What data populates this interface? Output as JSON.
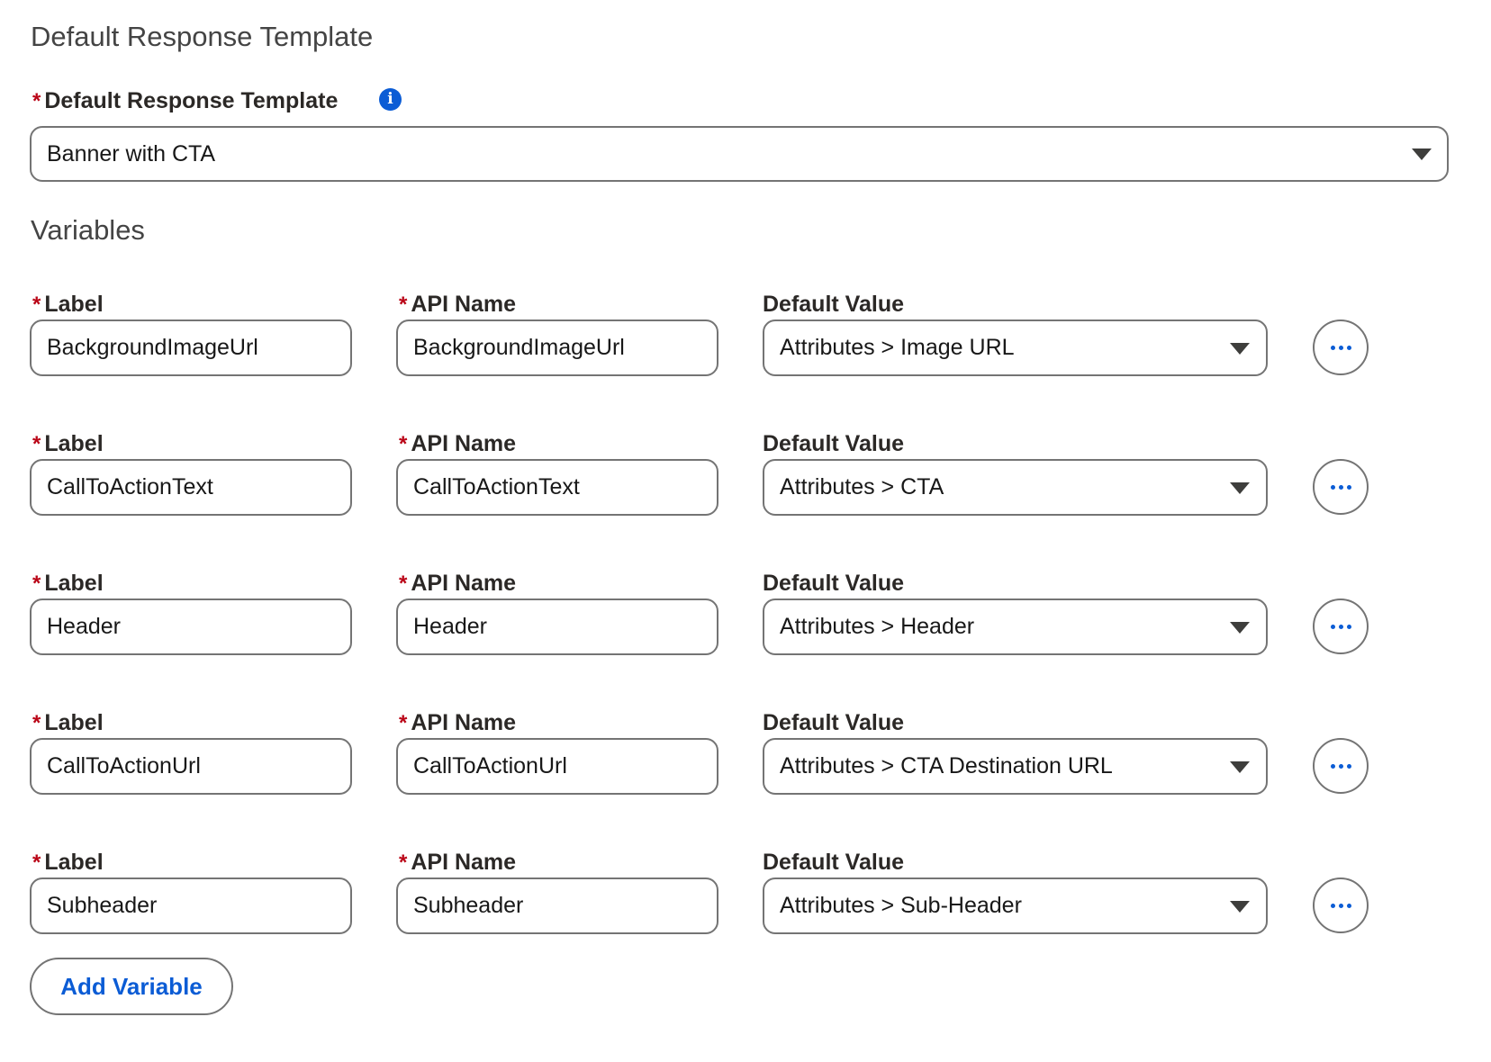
{
  "template_section": {
    "title": "Default Response Template",
    "field_label": "Default Response Template",
    "required_marker": "*",
    "info_icon": "info-icon",
    "selected_value": "Banner with CTA"
  },
  "variables_section": {
    "title": "Variables",
    "required_marker": "*",
    "rows": [
      {
        "label_header": "Label",
        "api_header": "API Name",
        "default_header": "Default Value",
        "label": "BackgroundImageUrl",
        "api_name": "BackgroundImageUrl",
        "default_value": "Attributes > Image URL"
      },
      {
        "label_header": "Label",
        "api_header": "API Name",
        "default_header": "Default Value",
        "label": "CallToActionText",
        "api_name": "CallToActionText",
        "default_value": "Attributes > CTA"
      },
      {
        "label_header": "Label",
        "api_header": "API Name",
        "default_header": "Default Value",
        "label": "Header",
        "api_name": "Header",
        "default_value": "Attributes > Header"
      },
      {
        "label_header": "Label",
        "api_header": "API Name",
        "default_header": "Default Value",
        "label": "CallToActionUrl",
        "api_name": "CallToActionUrl",
        "default_value": "Attributes > CTA Destination URL"
      },
      {
        "label_header": "Label",
        "api_header": "API Name",
        "default_header": "Default Value",
        "label": "Subheader",
        "api_name": "Subheader",
        "default_value": "Attributes > Sub-Header"
      }
    ],
    "more_actions_icon": "ellipsis-icon",
    "add_button_label": "Add Variable"
  },
  "colors": {
    "accent": "#0b5cd5",
    "required": "#ba0517",
    "border": "#747474"
  }
}
